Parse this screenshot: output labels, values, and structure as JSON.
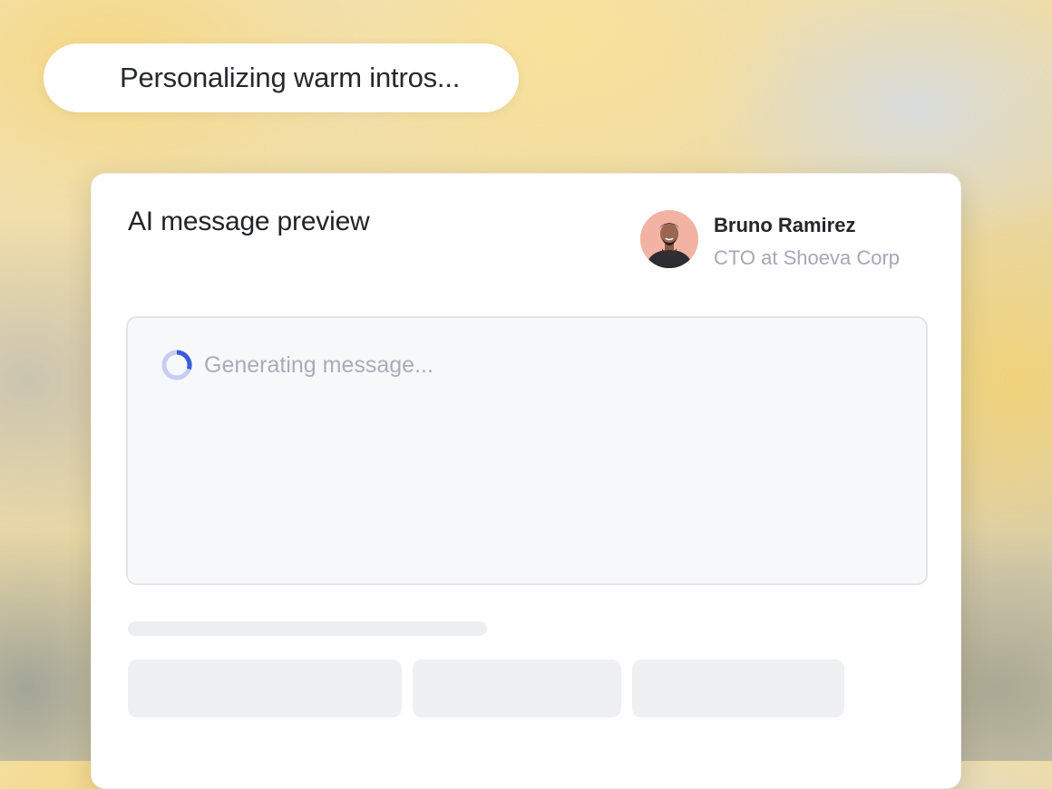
{
  "status": {
    "text": "Personalizing warm intros..."
  },
  "preview": {
    "title": "AI message preview",
    "recipient": {
      "name": "Bruno Ramirez",
      "role": "CTO at Shoeva Corp"
    },
    "message": {
      "loading_text": "Generating message...",
      "loading_icon": "spinner-icon"
    }
  },
  "colors": {
    "spinner_accent": "#3b5bdb",
    "spinner_track": "#c6ccf5",
    "avatar_background": "#f2b3a4"
  }
}
